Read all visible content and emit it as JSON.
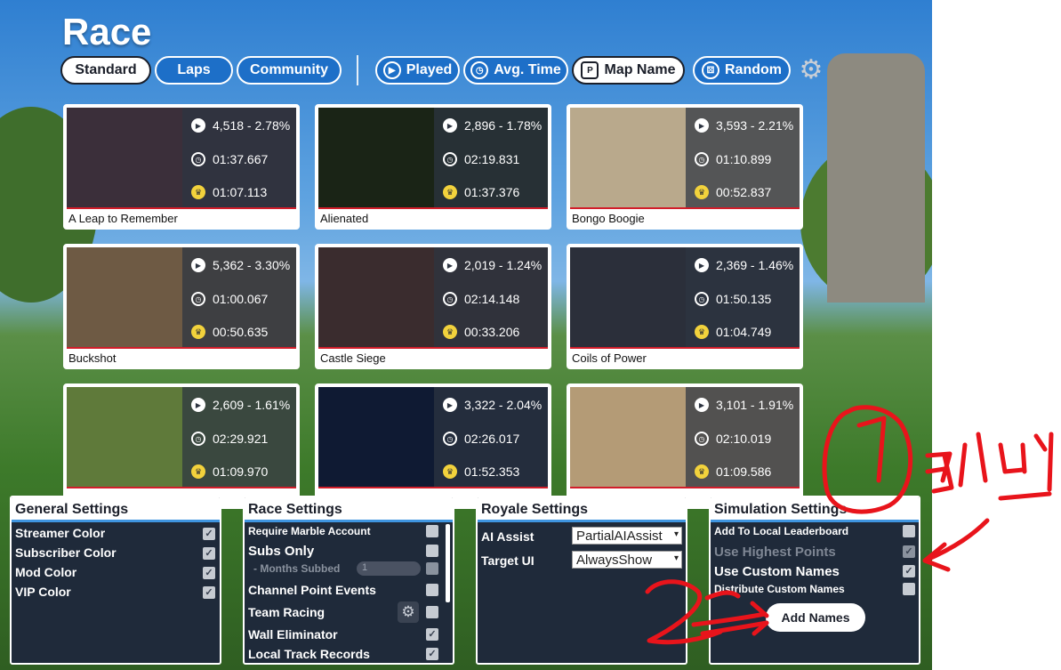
{
  "title": "Race",
  "filters": [
    "Standard",
    "Laps",
    "Community"
  ],
  "sorts": [
    {
      "label": "Played",
      "icon": "play-circle-icon"
    },
    {
      "label": "Avg. Time",
      "icon": "clock-icon"
    },
    {
      "label": "Map Name",
      "icon": "map-name-icon"
    },
    {
      "label": "Random",
      "icon": "dice-icon"
    }
  ],
  "tracks": [
    {
      "name": "A Leap to Remember",
      "plays": "4,518 - 2.78%",
      "avg": "01:37.667",
      "best": "01:07.113",
      "thumb": "#3b2f3a"
    },
    {
      "name": "Alienated",
      "plays": "2,896 - 1.78%",
      "avg": "02:19.831",
      "best": "01:37.376",
      "thumb": "#1a2416"
    },
    {
      "name": "Bongo Boogie",
      "plays": "3,593 - 2.21%",
      "avg": "01:10.899",
      "best": "00:52.837",
      "thumb": "#b9a98c"
    },
    {
      "name": "Buckshot",
      "plays": "5,362 - 3.30%",
      "avg": "01:00.067",
      "best": "00:50.635",
      "thumb": "#6e5a44"
    },
    {
      "name": "Castle Siege",
      "plays": "2,019 - 1.24%",
      "avg": "02:14.148",
      "best": "00:33.206",
      "thumb": "#3a2c2e"
    },
    {
      "name": "Coils of Power",
      "plays": "2,369 - 1.46%",
      "avg": "01:50.135",
      "best": "01:04.749",
      "thumb": "#2b2f3a"
    },
    {
      "name": "",
      "plays": "2,609 - 1.61%",
      "avg": "02:29.921",
      "best": "01:09.970",
      "thumb": "#5f7a3a"
    },
    {
      "name": "",
      "plays": "3,322 - 2.04%",
      "avg": "02:26.017",
      "best": "01:52.353",
      "thumb": "#0f1a33"
    },
    {
      "name": "",
      "plays": "3,101 - 1.91%",
      "avg": "02:10.019",
      "best": "01:09.586",
      "thumb": "#b49b76"
    }
  ],
  "general": {
    "title": "General Settings",
    "items": [
      "Streamer Color",
      "Subscriber Color",
      "Mod Color",
      "VIP Color"
    ]
  },
  "race": {
    "title": "Race Settings",
    "items": [
      "Require Marble Account",
      "Subs Only",
      "- Months Subbed",
      "Channel Point Events",
      "Team Racing",
      "Wall Eliminator",
      "Local Track Records"
    ],
    "months_value": "1"
  },
  "royale": {
    "title": "Royale Settings",
    "ai_assist_label": "AI Assist",
    "ai_assist_value": "PartialAIAssist",
    "target_ui_label": "Target UI",
    "target_ui_value": "AlwaysShow"
  },
  "simulation": {
    "title": "Simulation Settings",
    "items": [
      "Add To Local Leaderboard",
      "Use Highest Points",
      "Use Custom Names",
      "Distribute Custom Names"
    ],
    "add_names": "Add Names"
  },
  "annotation": {
    "mark1": "1",
    "mark2": "2",
    "note": "ㅋ니끄"
  },
  "colors": {
    "accent": "#1d6fc8",
    "panel": "#1f2a3a",
    "red_line": "#d21d2a",
    "annotation": "#e8141b"
  }
}
